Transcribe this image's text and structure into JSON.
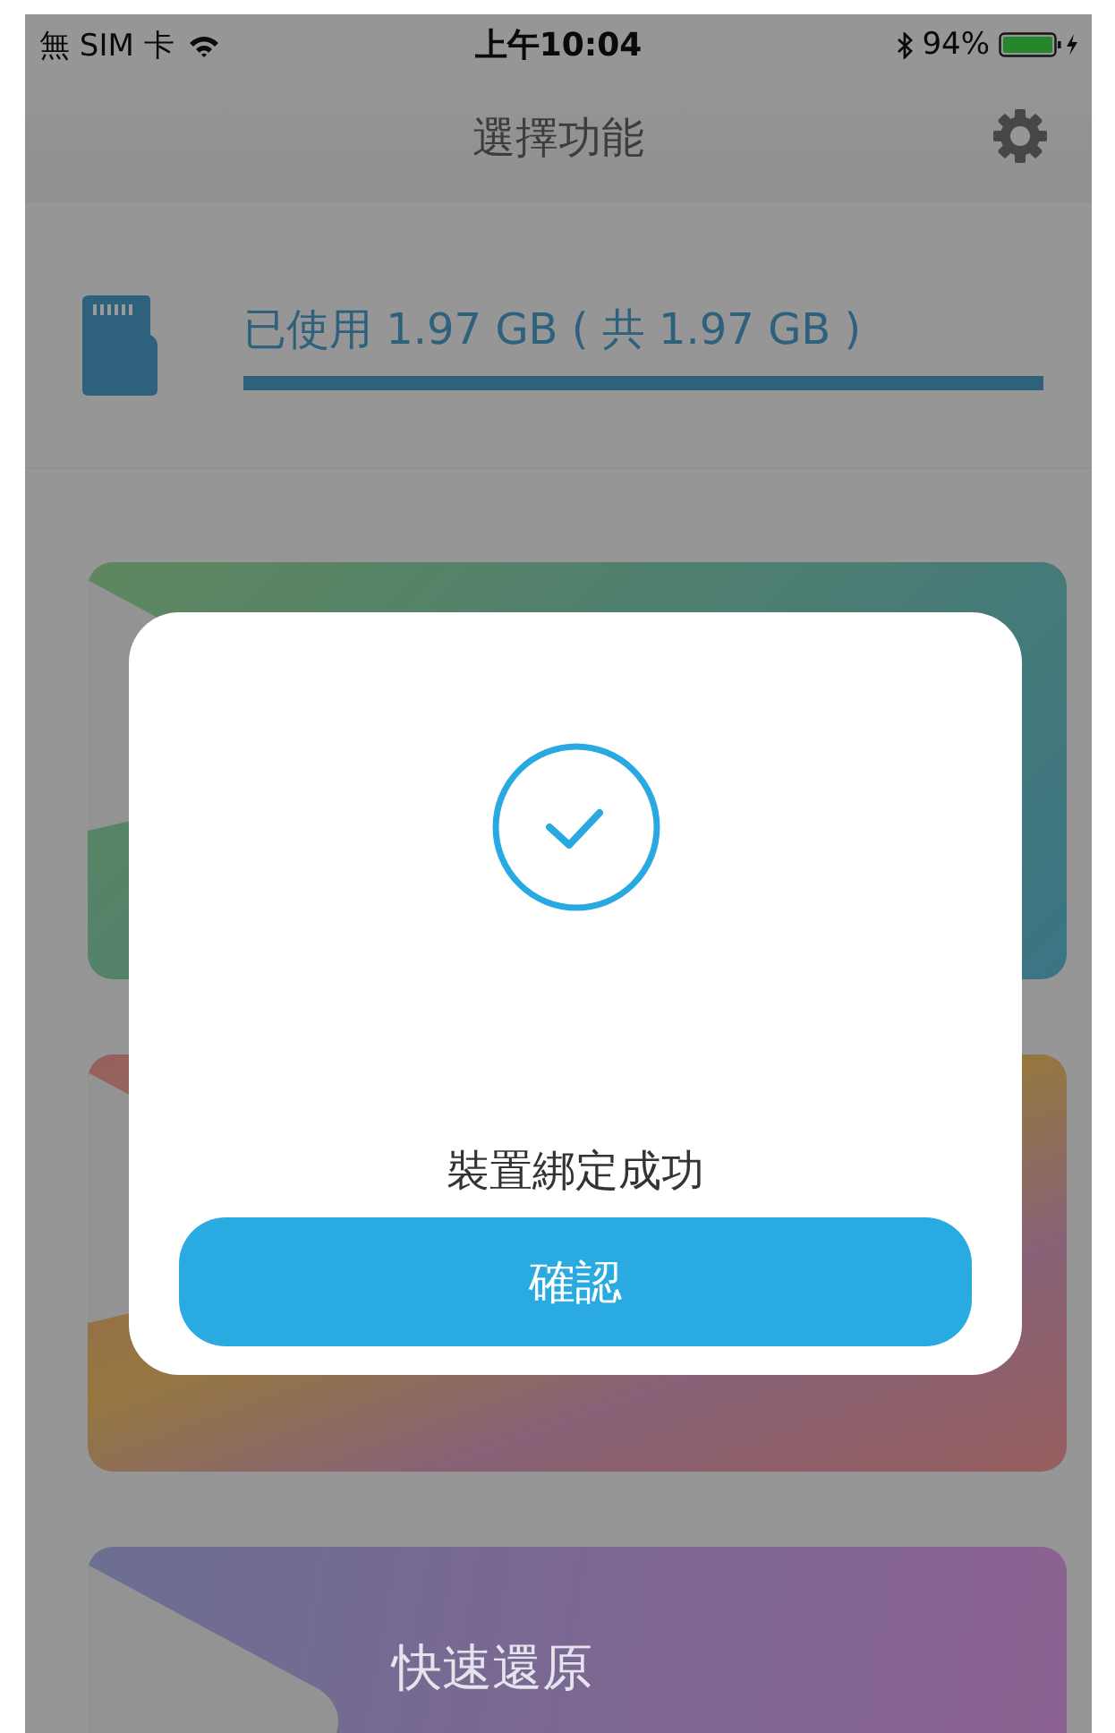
{
  "status_bar": {
    "carrier": "無 SIM 卡",
    "time": "上午10:04",
    "battery": "94%"
  },
  "header": {
    "title": "選擇功能"
  },
  "storage": {
    "text": "已使用 1.97 GB ( 共 1.97 GB )",
    "level": 1
  },
  "cards": [
    {
      "kind": "blank"
    },
    {
      "kind": "blank"
    },
    {
      "kind": "titled",
      "title": "快速還原"
    }
  ],
  "dialog": {
    "message": "裝置綁定成功",
    "confirm": "確認"
  }
}
